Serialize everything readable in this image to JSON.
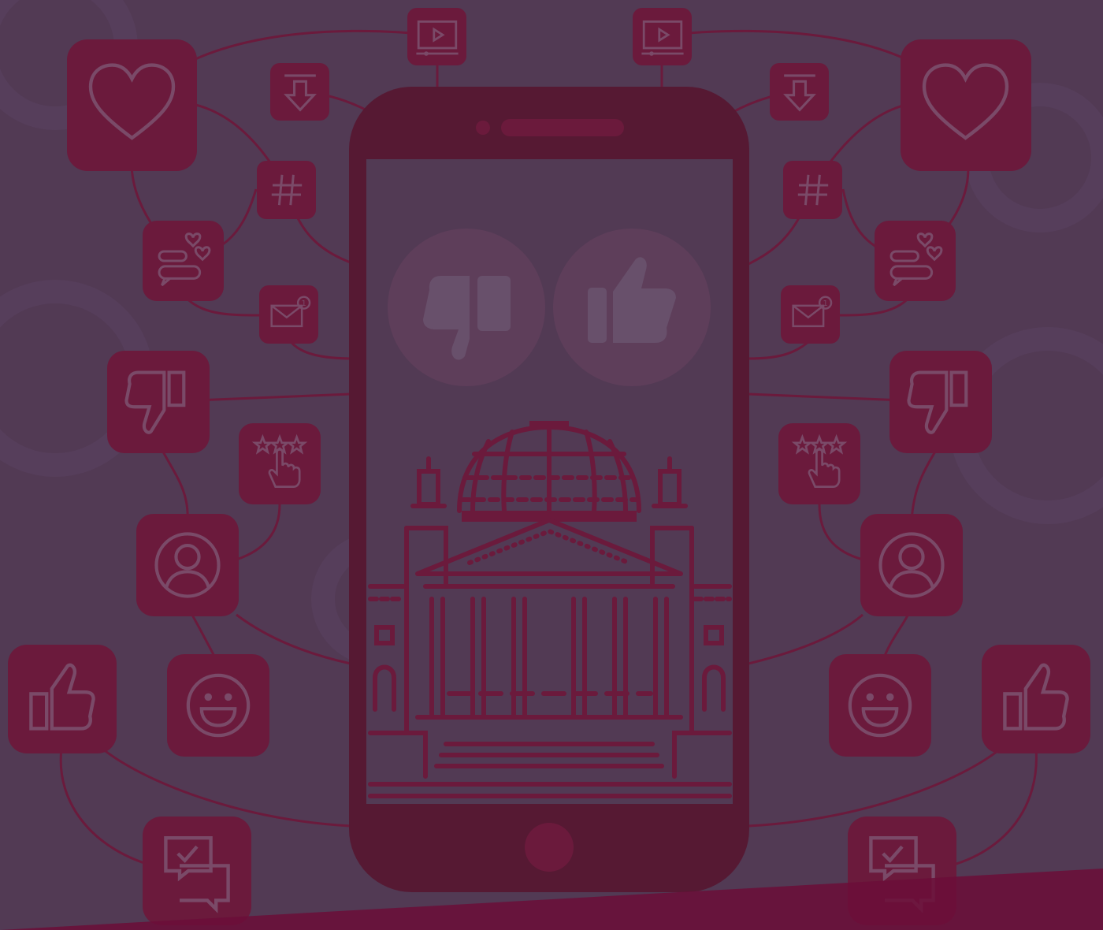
{
  "colors": {
    "background": "#523a54",
    "tile": "#6b1a3c",
    "phone_body": "#561933",
    "outline": "#7a4a68",
    "screen": "#523a54",
    "building": "#6b1a3c",
    "reaction_circle": "#5e3e5a",
    "reaction_icon": "#68506b",
    "bottom_band": "#6b0e38"
  },
  "illustration": {
    "subject": "smartphone-social-media-network",
    "phone": {
      "screen_icons": [
        "thumbs-down-icon",
        "thumbs-up-icon"
      ],
      "screen_image": "reichstag-building"
    },
    "left_icons": [
      "video-player-icon",
      "heart-icon",
      "download-icon",
      "hashtag-icon",
      "chat-hearts-icon",
      "mail-notification-icon",
      "thumbs-down-icon",
      "rating-stars-icon",
      "user-profile-icon",
      "smiley-icon",
      "thumbs-up-icon",
      "chat-check-icon"
    ],
    "right_icons": [
      "video-player-icon",
      "heart-icon",
      "download-icon",
      "hashtag-icon",
      "chat-hearts-icon",
      "mail-notification-icon",
      "thumbs-down-icon",
      "rating-stars-icon",
      "user-profile-icon",
      "smiley-icon",
      "thumbs-up-icon",
      "chat-check-icon"
    ]
  }
}
